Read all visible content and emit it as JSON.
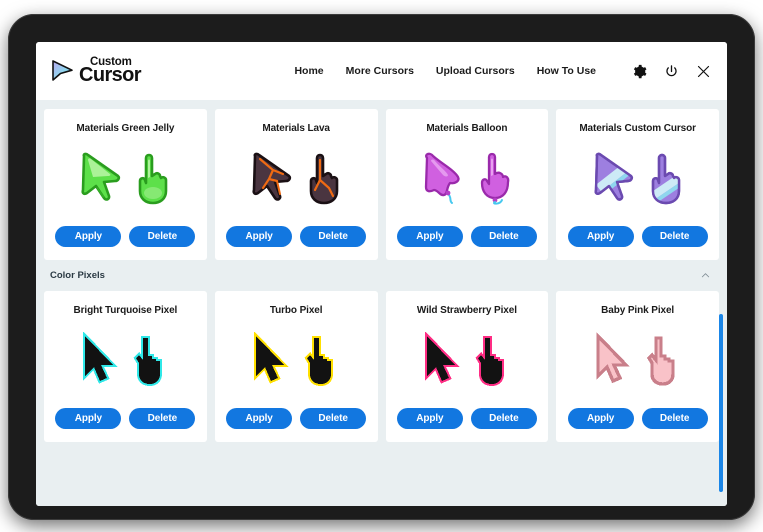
{
  "header": {
    "logo": {
      "top_word": "Custom",
      "bottom_word": "Cursor",
      "icon": "cursor-arrow-logo-icon"
    },
    "nav": [
      {
        "label": "Home",
        "name": "nav-home"
      },
      {
        "label": "More Cursors",
        "name": "nav-more-cursors"
      },
      {
        "label": "Upload Cursors",
        "name": "nav-upload-cursors"
      },
      {
        "label": "How To Use",
        "name": "nav-how-to-use"
      }
    ],
    "icons": [
      {
        "name": "gear-icon"
      },
      {
        "name": "power-icon"
      },
      {
        "name": "close-icon"
      }
    ]
  },
  "buttons": {
    "apply_label": "Apply",
    "delete_label": "Delete"
  },
  "section": {
    "title": "Color Pixels",
    "collapse_icon": "chevron-up-icon"
  },
  "rows": [
    {
      "cards": [
        {
          "title": "Materials Green Jelly",
          "style": "jelly",
          "fill": "#5de04a",
          "shade": "#3bb82c",
          "light": "#b8f5a6",
          "stroke": "#2a9d1e"
        },
        {
          "title": "Materials Lava",
          "style": "jelly",
          "fill": "#4a3540",
          "shade": "#2e2028",
          "light": "#6d4d58",
          "stroke": "#1a1014",
          "accent": "#ef6a12"
        },
        {
          "title": "Materials Balloon",
          "style": "jelly",
          "fill": "#d060e0",
          "shade": "#b43fc6",
          "light": "#eaa8f2",
          "stroke": "#9a2aab",
          "accent": "#46c8ef"
        },
        {
          "title": "Materials Custom Cursor",
          "style": "jelly",
          "fill": "#9d7fe0",
          "shade": "#7d5ec6",
          "light": "#c0aef0",
          "stroke": "#6b4ab0",
          "accent": "#8fd6ee"
        }
      ]
    },
    {
      "cards": [
        {
          "title": "Bright Turquoise Pixel",
          "style": "pixel",
          "fill": "#121212",
          "stroke": "#2fe8e8"
        },
        {
          "title": "Turbo Pixel",
          "style": "pixel",
          "fill": "#121212",
          "stroke": "#ffe000"
        },
        {
          "title": "Wild Strawberry Pixel",
          "style": "pixel",
          "fill": "#121212",
          "stroke": "#ff2d84"
        },
        {
          "title": "Baby Pink Pixel",
          "style": "pixel",
          "fill": "#f9c2c8",
          "stroke": "#c97f8a"
        }
      ]
    }
  ],
  "colors": {
    "button_blue": "#1277e0",
    "background": "#e9eff1",
    "card": "#ffffff",
    "scrollbar": "#1a86e8",
    "bezel": "#1c1c1c"
  }
}
